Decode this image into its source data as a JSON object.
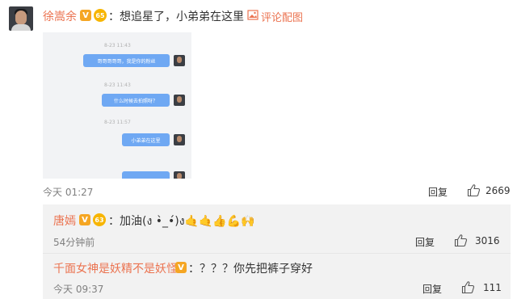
{
  "main_comment": {
    "username": "徐嵩余",
    "verified_badge": "V",
    "medal_label": "65",
    "text": "想追星了，小弟弟在这里",
    "image_link": "评论配图",
    "time": "今天 01:27",
    "reply_label": "回复",
    "likes": "2669"
  },
  "screenshot": {
    "timestamps": [
      "8-23 11:43",
      "8-23 11:43",
      "8-23 11:57"
    ],
    "bubbles": [
      "哥哥哥哥哥，我是你的粉丝",
      "什么时候去拍照呀？",
      "小弟弟在这里"
    ]
  },
  "replies": [
    {
      "username": "唐嫣",
      "verified_badge": "V",
      "medal_label": "63",
      "text": "加油(ง •̀_•́)ง🤙🤙👍💪🙌",
      "time": "54分钟前",
      "reply_label": "回复",
      "likes": "3016"
    },
    {
      "username": "千面女神是妖精不是妖怪",
      "verified_badge": "V",
      "text": "：？？？你先把裤子穿好",
      "time": "今天 09:37",
      "reply_label": "回复",
      "likes": "111"
    }
  ],
  "icons": {
    "image_link_icon": "image-icon",
    "like_icon": "thumbs-up-icon"
  },
  "colors": {
    "username": "#eb7350",
    "badge": "#f5a623",
    "bubble": "#6fa8f3",
    "sub_background": "#f2f2f2"
  }
}
